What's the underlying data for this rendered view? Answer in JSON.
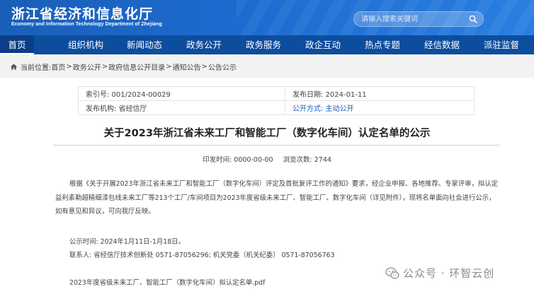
{
  "header": {
    "title": "浙江省经济和信息化厅",
    "subtitle": "Economy and Information Technology Department of Zhejiang",
    "search_placeholder": "请输入搜索关键词"
  },
  "nav": {
    "items": [
      {
        "label": "首页"
      },
      {
        "label": "组织机构"
      },
      {
        "label": "新闻动态"
      },
      {
        "label": "政务公开"
      },
      {
        "label": "政务服务"
      },
      {
        "label": "政企互动"
      },
      {
        "label": "热点专题"
      },
      {
        "label": "经信数据"
      },
      {
        "label": "派驻监督"
      }
    ]
  },
  "breadcrumb": {
    "prefix": "当前位置:",
    "items": [
      "首页",
      "政务公开",
      "政府信息公开目录",
      "通知公告",
      "公告公示"
    ],
    "separator": ">"
  },
  "info": {
    "index_no": "索引号: 001/2024-00029",
    "publish_date": "发布日期: 2024-01-11",
    "publisher": "发布机构: 省经信厅",
    "open_method": "公开方式: 主动公开"
  },
  "article": {
    "title": "关于2023年浙江省未来工厂和智能工厂（数字化车间）认定名单的公示",
    "print_time": "印发时间:  0000-00-00",
    "views": "浏览次数:  2744",
    "paragraph": "根据《关于开展2023年浙江省未来工厂和智能工厂（数字化车间）评定及首批复评工作的通知》要求，经企业申报、各地推荐、专家评审，拟认定益利素勒超精细漆包线未来工厂等213个工厂/车间项目为2023年度省级未来工厂、智能工厂、数字化车间（详见附件），现将名单面向社会进行公示，如有意见和异议，可向我厅反映。",
    "period": "公示时间:  2024年1月11日-1月18日。",
    "contact": "联系人:  省经信厅技术创新处 0571-87056296;  机关党委（机关纪委） 0571-87056763",
    "attachment": "2023年度省级未来工厂、智能工厂（数字化车间）拟认定名单.pdf"
  },
  "watermark": {
    "text": "公众号 · 环智云创"
  },
  "colors": {
    "header_blue": "#1d6bd0",
    "nav_blue": "#0d4d9e",
    "link_blue": "#1a5fb8"
  }
}
